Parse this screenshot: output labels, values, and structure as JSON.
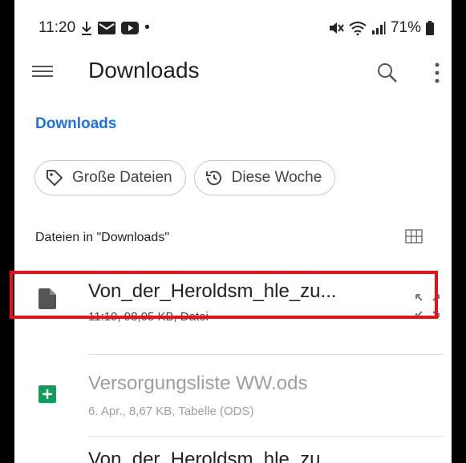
{
  "status_bar": {
    "time": "11:20",
    "notification_icons": [
      "download-icon",
      "mail-icon",
      "youtube-icon"
    ],
    "dot": "•",
    "system_icons": [
      "mute-icon",
      "wifi-icon",
      "signal-icon"
    ],
    "battery": "71%"
  },
  "appbar": {
    "title": "Downloads"
  },
  "breadcrumb": "Downloads",
  "chips": [
    {
      "label": "Große Dateien",
      "icon": "tag-icon"
    },
    {
      "label": "Diese Woche",
      "icon": "history-icon"
    }
  ],
  "section_label": "Dateien in \"Downloads\"",
  "files": [
    {
      "name": "Von_der_Heroldsm_hle_zu...",
      "meta": "11:19, 98,05 KB, Datei",
      "icon": "document-icon",
      "highlighted": true
    },
    {
      "name": "Versorgungsliste WW.ods",
      "meta": "6. Apr., 8,67 KB, Tabelle (ODS)",
      "icon": "spreadsheet-icon",
      "highlighted": false
    },
    {
      "name": "Von_der_Heroldsm_hle_zu",
      "meta": "",
      "icon": "document-icon",
      "highlighted": false
    }
  ],
  "colors": {
    "accent": "#1a73e8",
    "highlight_border": "#e8111a",
    "sheets_green": "#0f9d58"
  }
}
